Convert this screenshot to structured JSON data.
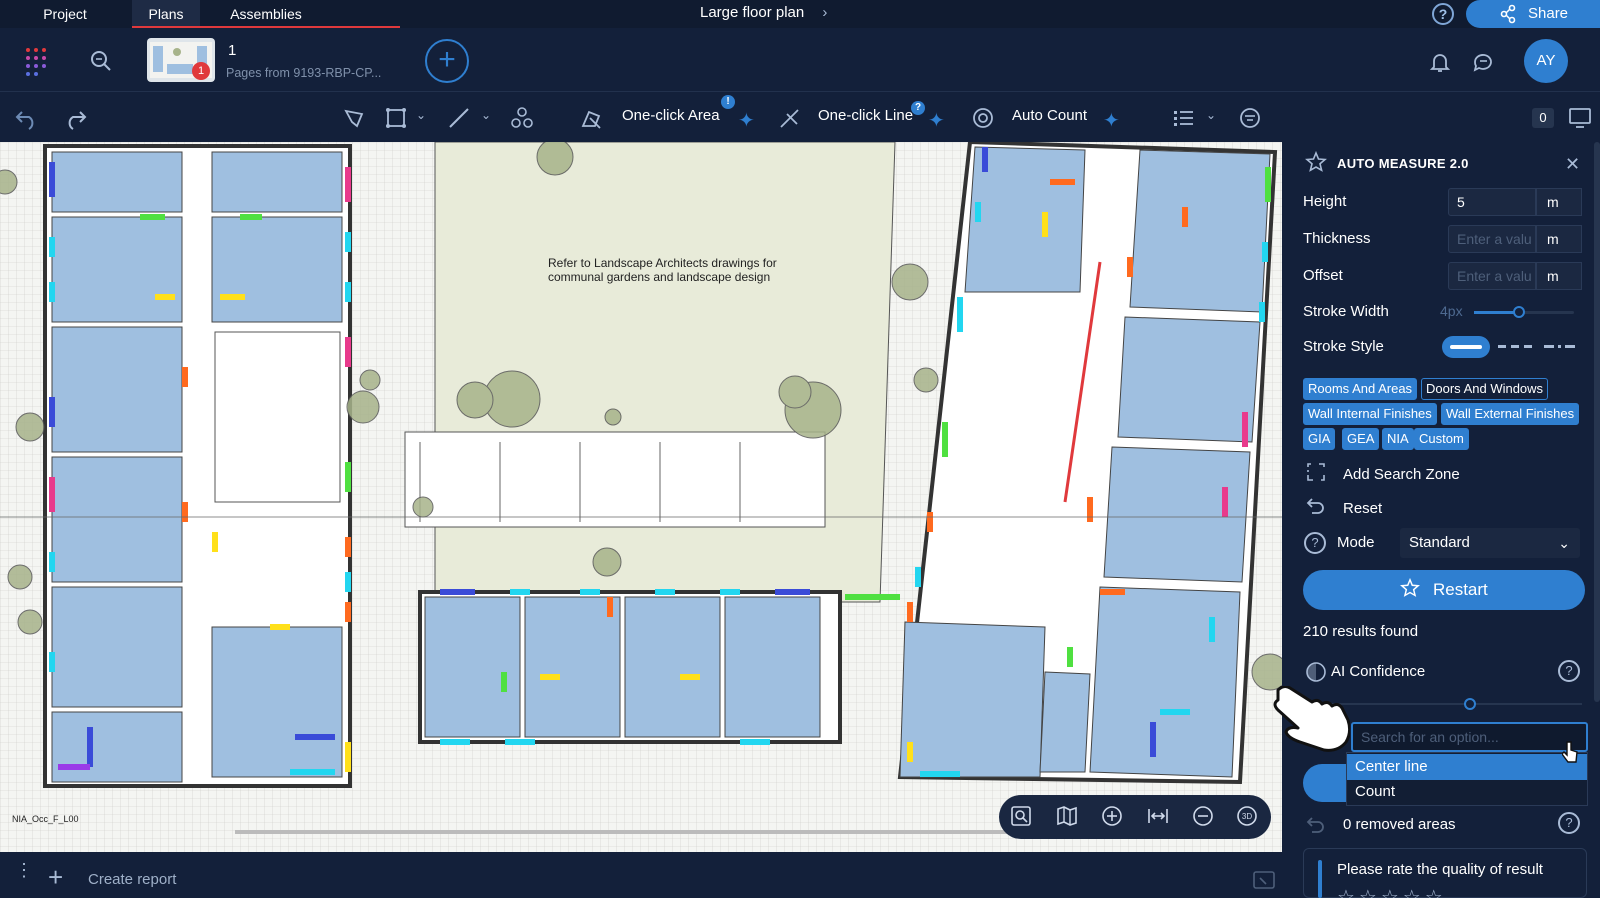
{
  "tabs": {
    "project": "Project",
    "plans": "Plans",
    "assemblies": "Assemblies"
  },
  "header": {
    "title": "Large floor plan",
    "share_label": "Share",
    "page_number": "1",
    "page_source": "Pages from 9193-RBP-CP...",
    "thumbnail_badge": "1",
    "avatar_initials": "AY",
    "help_glyph": "?"
  },
  "toolbar": {
    "one_click_area": "One-click Area",
    "one_click_line": "One-click Line",
    "auto_count": "Auto Count",
    "area_info_badge": "!",
    "line_info_badge": "?",
    "layers_count": "0"
  },
  "canvas": {
    "note": "Refer to Landscape Architects drawings for communal gardens and landscape design",
    "label_nia": "NIA_Occ_F_L00"
  },
  "panel": {
    "title": "AUTO MEASURE 2.0",
    "height_label": "Height",
    "height_value": "5",
    "height_unit": "m",
    "thickness_label": "Thickness",
    "thickness_placeholder": "Enter a valu",
    "thickness_unit": "m",
    "offset_label": "Offset",
    "offset_placeholder": "Enter a valu",
    "offset_unit": "m",
    "stroke_width_label": "Stroke Width",
    "stroke_width_value": "4px",
    "stroke_width_level": 0.45,
    "stroke_style_label": "Stroke Style",
    "chips": [
      "Rooms And Areas",
      "Doors And Windows",
      "Wall Internal Finishes",
      "Wall External Finishes",
      "GIA",
      "GEA",
      "NIA",
      "Custom"
    ],
    "add_search_zone": "Add Search Zone",
    "reset": "Reset",
    "mode_label": "Mode",
    "mode_value": "Standard",
    "restart": "Restart",
    "results": "210 results found",
    "ai_confidence": "AI Confidence",
    "dropdown_placeholder": "Search for an option...",
    "dropdown_options": [
      "Center line",
      "Count"
    ],
    "removed_areas": "0 removed areas",
    "rate_prompt": "Please rate the quality of result"
  },
  "bottom": {
    "create_report": "Create report"
  },
  "colors": {
    "accent": "#2f7fd0",
    "background": "#13203a",
    "tab_underline": "#e0393c"
  }
}
